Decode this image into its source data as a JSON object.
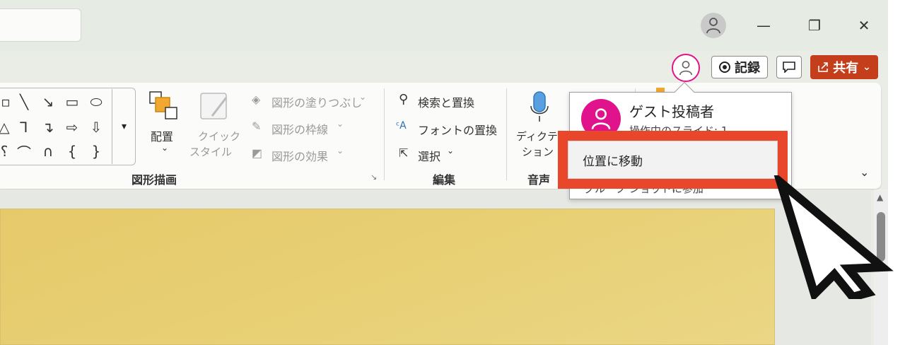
{
  "window": {
    "minimize_glyph": "—",
    "restore_glyph": "❐",
    "close_glyph": "✕"
  },
  "collab": {
    "record_label": "記録",
    "share_label": "共有",
    "share_chevron": "⌄"
  },
  "ribbon": {
    "drawing_group": {
      "label": "図形描画",
      "arrange_label": "配置",
      "quick_style_line1": "クイック",
      "quick_style_line2": "スタイル",
      "fill_label": "図形の塗りつぶし",
      "outline_label": "図形の枠線",
      "effects_label": "図形の効果"
    },
    "editing_group": {
      "label": "編集",
      "find_label": "検索と置換",
      "replace_font_label": "フォントの置換",
      "select_label": "選択"
    },
    "voice_group": {
      "label": "音声",
      "dictate_line1": "ディクテー",
      "dictate_line2": "ション"
    }
  },
  "popup": {
    "name": "ゲスト投稿者",
    "status": "操作中のスライド: 1",
    "goto_label": "位置に移動",
    "join_label": "グループ ショットに参加"
  },
  "colors": {
    "accent_pink": "#e0138c",
    "share_red": "#c43e1c",
    "highlight_red": "#e8472b",
    "slide_gold": "#e8d076"
  }
}
